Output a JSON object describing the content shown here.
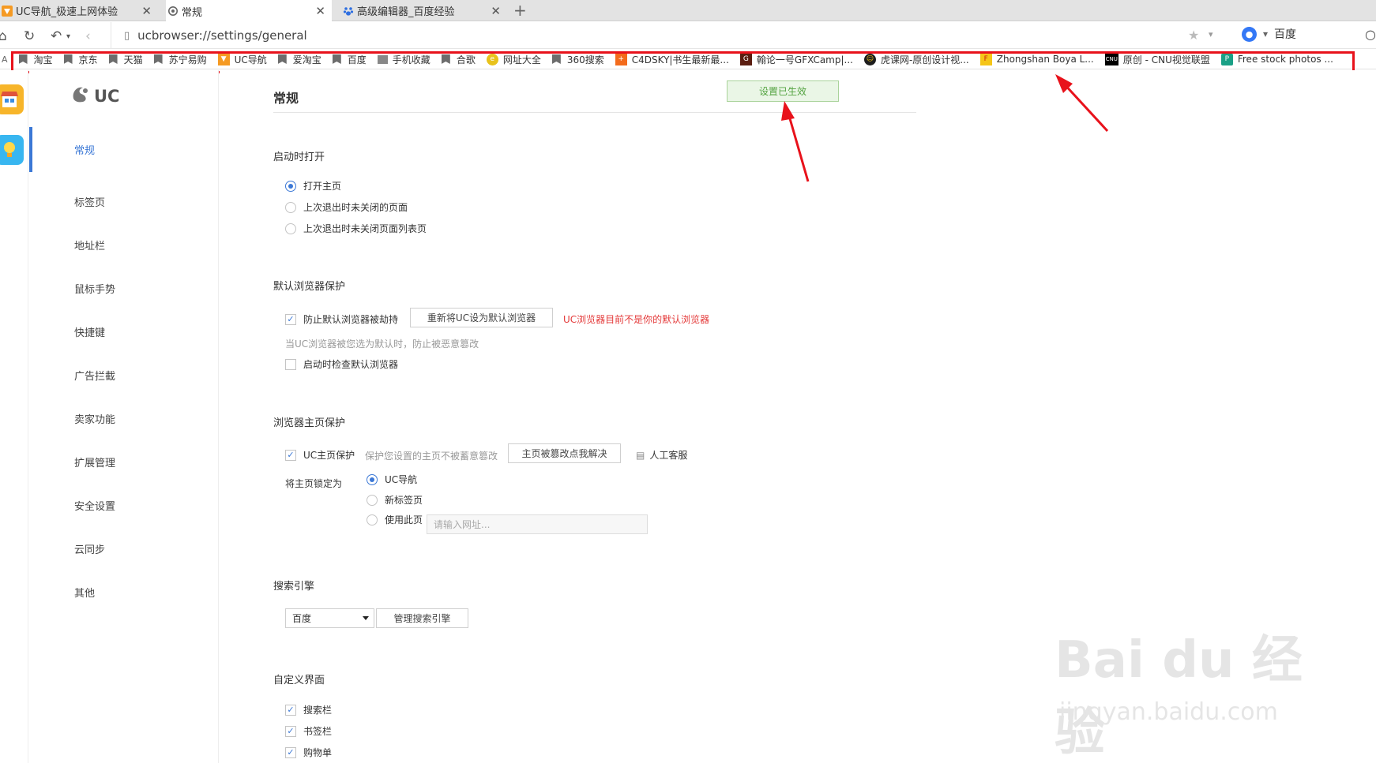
{
  "tabs": [
    {
      "label": "UC导航_极速上网体验",
      "icon": "uc-nav-icon",
      "active": false
    },
    {
      "label": "常规",
      "icon": "gear-icon",
      "active": true
    },
    {
      "label": "高级编辑器_百度经验",
      "icon": "baidu-paw-icon",
      "active": false
    }
  ],
  "address": {
    "url": "ucbrowser://settings/general",
    "search_engine": "百度"
  },
  "bookmarks": [
    {
      "label": "淘宝",
      "icon": "folder"
    },
    {
      "label": "京东",
      "icon": "folder"
    },
    {
      "label": "天猫",
      "icon": "folder"
    },
    {
      "label": "苏宁易购",
      "icon": "folder"
    },
    {
      "label": "UC导航",
      "icon": "uc"
    },
    {
      "label": "爱淘宝",
      "icon": "folder"
    },
    {
      "label": "百度",
      "icon": "folder"
    },
    {
      "label": "手机收藏",
      "icon": "folder"
    },
    {
      "label": "合歌",
      "icon": "folder"
    },
    {
      "label": "网址大全",
      "icon": "globe"
    },
    {
      "label": "360搜索",
      "icon": "folder"
    },
    {
      "label": "C4DSKY|书生最新最...",
      "icon": "c4d"
    },
    {
      "label": "翰论一号GFXCamp|...",
      "icon": "gfx"
    },
    {
      "label": "虎课网-原创设计视...",
      "icon": "huke"
    },
    {
      "label": "Zhongshan Boya L...",
      "icon": "boya"
    },
    {
      "label": "原创 - CNU视觉联盟",
      "icon": "cnu"
    },
    {
      "label": "Free stock photos ...",
      "icon": "pexels"
    }
  ],
  "sidebar": {
    "logo": "UC",
    "items": [
      {
        "label": "常规",
        "active": true
      },
      {
        "label": "标签页"
      },
      {
        "label": "地址栏"
      },
      {
        "label": "鼠标手势"
      },
      {
        "label": "快捷键"
      },
      {
        "label": "广告拦截"
      },
      {
        "label": "卖家功能"
      },
      {
        "label": "扩展管理"
      },
      {
        "label": "安全设置"
      },
      {
        "label": "云同步"
      },
      {
        "label": "其他"
      }
    ]
  },
  "main": {
    "title": "常规",
    "toast": "设置已生效",
    "startup": {
      "label": "启动时打开",
      "options": [
        "打开主页",
        "上次退出时未关闭的页面",
        "上次退出时未关闭页面列表页"
      ],
      "selected": 0
    },
    "default_browser": {
      "label": "默认浏览器保护",
      "prevent_hijack": "防止默认浏览器被劫持",
      "reset_button": "重新将UC设为默认浏览器",
      "warning": "UC浏览器目前不是你的默认浏览器",
      "hint": "当UC浏览器被您选为默认时，防止被恶意篡改",
      "check_on_start": "启动时检查默认浏览器"
    },
    "homepage": {
      "label": "浏览器主页保护",
      "protect": "UC主页保护",
      "protect_hint": "保护您设置的主页不被蓄意篡改",
      "fix_button": "主页被篡改点我解决",
      "service": "人工客服",
      "lock_label": "将主页锁定为",
      "options": [
        "UC导航",
        "新标签页",
        "使用此页"
      ],
      "url_placeholder": "请输入网址..."
    },
    "search": {
      "label": "搜索引擎",
      "selected": "百度",
      "manage_button": "管理搜索引擎"
    },
    "custom_ui": {
      "label": "自定义界面",
      "options": [
        "搜索栏",
        "书签栏",
        "购物单"
      ]
    }
  },
  "watermark": {
    "main": "Bai du 经验",
    "sub": "jingyan.baidu.com"
  },
  "colors": {
    "accent": "#3b78d6",
    "warning": "#e43a3a",
    "toast_text": "#53a340",
    "annotation_red": "#e8121b"
  }
}
